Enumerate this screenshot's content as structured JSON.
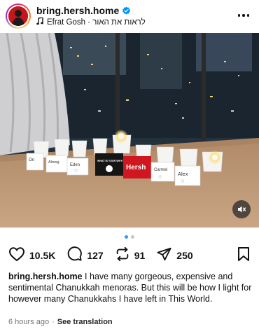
{
  "post": {
    "username": "bring.hersh.home",
    "audio": "Efrat Gosh · לראות את האור"
  },
  "photo": {
    "cup_names": [
      "Ori",
      "Almog",
      "Eden",
      "Hersh",
      "Carmel",
      "Alex"
    ],
    "book_text": "WHAT IS YOUR WHY?"
  },
  "actions": {
    "likes": "10.5K",
    "comments": "127",
    "reposts": "91",
    "shares": "250"
  },
  "caption": {
    "username": "bring.hersh.home",
    "text": " I have many gorgeous, expensive and sentimental Chanukkah menoras. But this will be how I light for however many Chanukkahs I have left in This World."
  },
  "meta": {
    "time": "6 hours ago",
    "separator": "·",
    "see_translation": "See translation"
  },
  "pager": {
    "count": 2,
    "active": 0
  },
  "colors": {
    "accent": "#3897f0",
    "brand_red": "#c4161c"
  }
}
